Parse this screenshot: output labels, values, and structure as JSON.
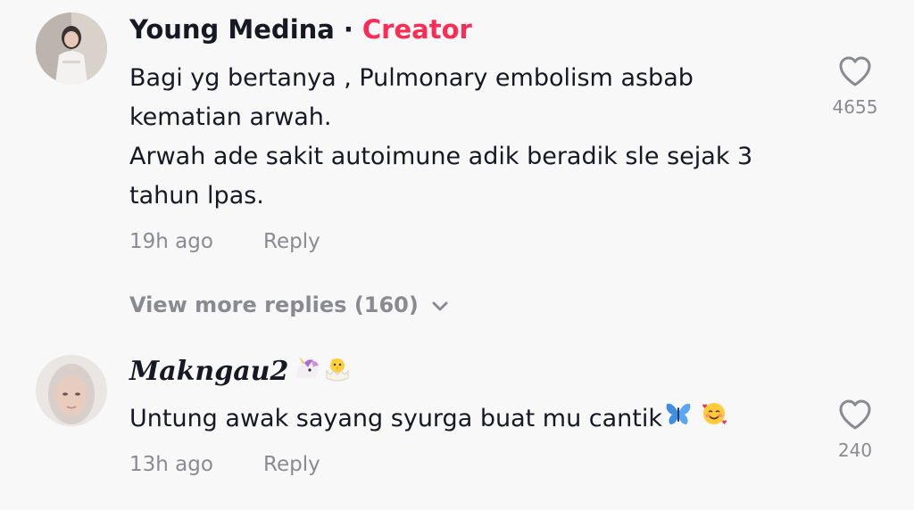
{
  "comments": [
    {
      "username": "Young Medina",
      "separator": "·",
      "badge": "Creator",
      "text_lines": [
        "Bagi yg bertanya , Pulmonary embolism asbab",
        "kematian arwah.",
        "Arwah ade sakit autoimune adik beradik sle sejak 3",
        "tahun lpas."
      ],
      "time": "19h ago",
      "reply_label": "Reply",
      "likes": "4655",
      "like_icon": "heart-outline-icon"
    },
    {
      "username": "Makngau2",
      "username_emoji": [
        "unicorn-emoji",
        "hatching-chick-emoji"
      ],
      "text": "Untung awak sayang syurga buat mu cantik",
      "text_emoji": [
        "butterfly-emoji",
        "smiling-face-with-hearts-emoji"
      ],
      "time": "13h ago",
      "reply_label": "Reply",
      "likes": "240",
      "like_icon": "heart-outline-icon"
    }
  ],
  "view_more": {
    "label": "View more replies (160)",
    "icon": "chevron-down-icon"
  },
  "colors": {
    "background": "#f8f8f8",
    "text_primary": "#161823",
    "text_secondary": "#8a8b91",
    "creator_accent": "#fe2c55"
  }
}
